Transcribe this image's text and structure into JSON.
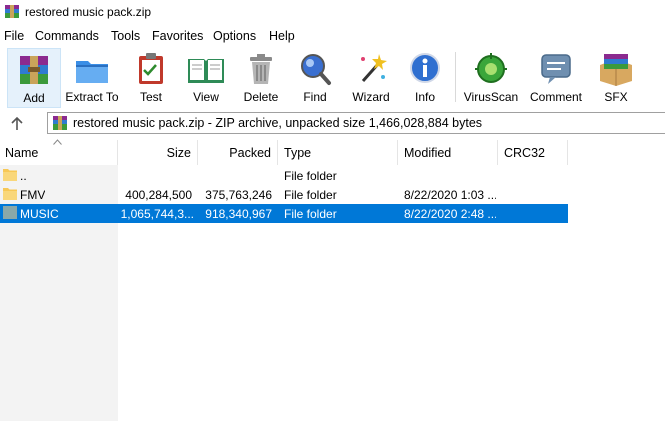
{
  "window": {
    "title": "restored music pack.zip"
  },
  "menu": [
    "File",
    "Commands",
    "Tools",
    "Favorites",
    "Options",
    "Help"
  ],
  "toolbar": [
    {
      "label": "Add",
      "icon": "add-archive-icon"
    },
    {
      "label": "Extract To",
      "icon": "extract-folder-icon"
    },
    {
      "label": "Test",
      "icon": "test-clipboard-icon"
    },
    {
      "label": "View",
      "icon": "view-book-icon"
    },
    {
      "label": "Delete",
      "icon": "trash-can-icon"
    },
    {
      "label": "Find",
      "icon": "magnifier-icon"
    },
    {
      "label": "Wizard",
      "icon": "magic-wand-icon"
    },
    {
      "label": "Info",
      "icon": "info-icon"
    },
    {
      "label": "VirusScan",
      "icon": "virus-scan-icon"
    },
    {
      "label": "Comment",
      "icon": "comment-icon"
    },
    {
      "label": "SFX",
      "icon": "sfx-box-icon"
    }
  ],
  "address": {
    "text": "restored music pack.zip - ZIP archive, unpacked size 1,466,028,884 bytes"
  },
  "columns": [
    "Name",
    "Size",
    "Packed",
    "Type",
    "Modified",
    "CRC32"
  ],
  "rows": [
    {
      "name": "..",
      "size": "",
      "packed": "",
      "type": "File folder",
      "modified": "",
      "crc": ""
    },
    {
      "name": "FMV",
      "size": "400,284,500",
      "packed": "375,763,246",
      "type": "File folder",
      "modified": "8/22/2020 1:03 ...",
      "crc": ""
    },
    {
      "name": "MUSIC",
      "size": "1,065,744,3...",
      "packed": "918,340,967",
      "type": "File folder",
      "modified": "8/22/2020 2:48 ...",
      "crc": ""
    }
  ],
  "colors": {
    "selection": "#0078d7",
    "folder": "#f7c856"
  }
}
